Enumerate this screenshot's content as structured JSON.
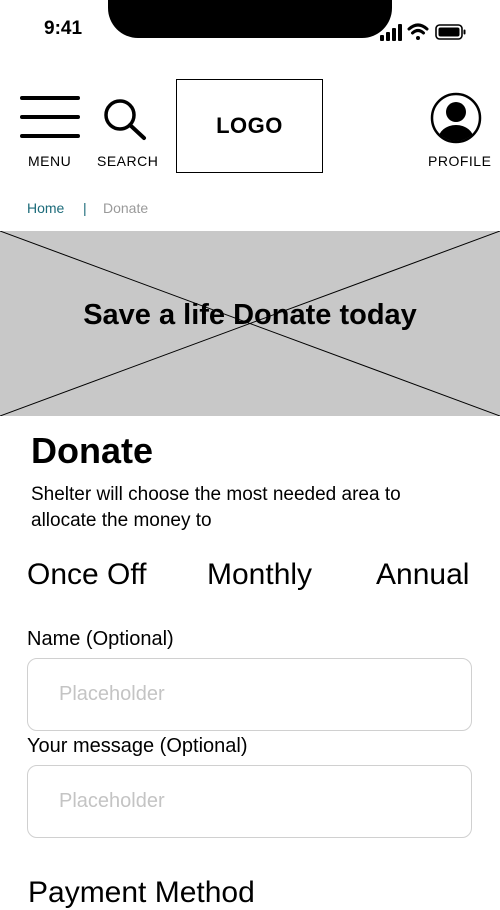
{
  "status_bar": {
    "time": "9:41",
    "icons": [
      "signal-icon",
      "wifi-icon",
      "battery-icon"
    ]
  },
  "header": {
    "menu_label": "MENU",
    "search_label": "SEARCH",
    "logo_text": "LOGO",
    "profile_label": "PROFILE"
  },
  "breadcrumb": {
    "home": "Home",
    "separator": "|",
    "current": "Donate"
  },
  "hero": {
    "text": "Save a life Donate today"
  },
  "donate": {
    "title": "Donate",
    "subtitle": "Shelter will choose the most needed area to allocate the money to",
    "frequency_options": [
      "Once Off",
      "Monthly",
      "Annual"
    ]
  },
  "form": {
    "name_label": "Name (Optional)",
    "name_placeholder": "Placeholder",
    "message_label": "Your message (Optional)",
    "message_placeholder": "Placeholder",
    "payment_heading": "Payment Method"
  },
  "colors": {
    "breadcrumb_link": "#1c6b7a",
    "breadcrumb_current": "#9a9a9a",
    "hero_bg": "#c8c8c8",
    "placeholder": "#c4c4c4",
    "field_border": "#d0d0d0"
  }
}
